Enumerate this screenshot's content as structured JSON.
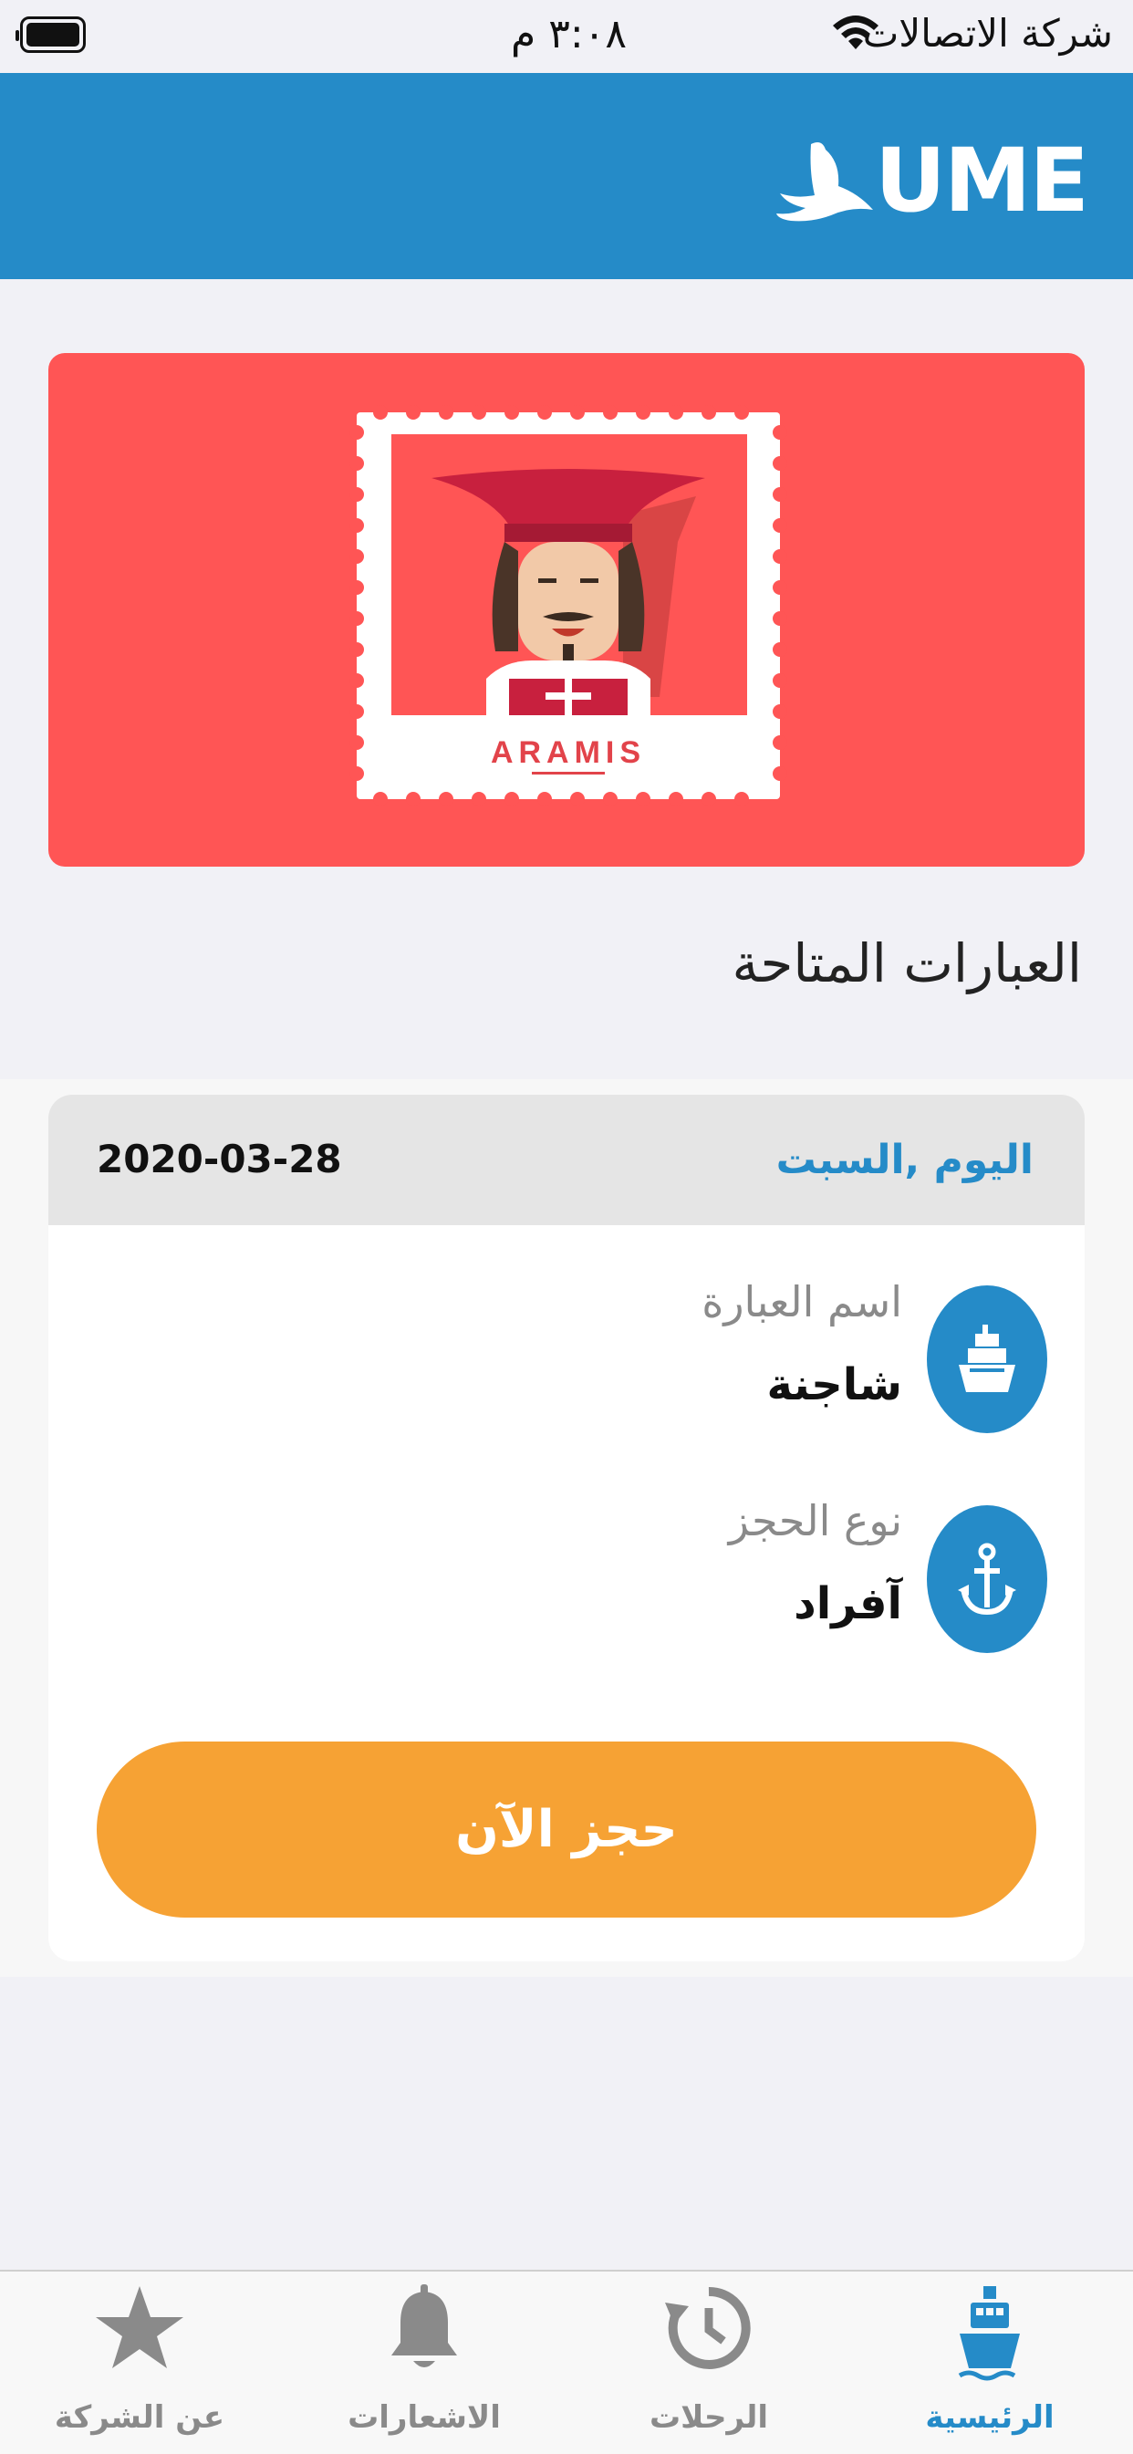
{
  "status_bar": {
    "time": "٣:٠٨ م",
    "carrier": "شركة الاتصالات"
  },
  "header": {
    "logo_text": "UME"
  },
  "hero": {
    "stamp_caption": "ARAMIS"
  },
  "section": {
    "title": "العبارات المتاحة"
  },
  "trip_card": {
    "day": "اليوم ,السبت",
    "date": "2020-03-28",
    "ferry_name_label": "اسم العبارة",
    "ferry_name_value": "شاجنة",
    "booking_type_label": "نوع الحجز",
    "booking_type_value": "آفراد",
    "book_button": "حجز الآن"
  },
  "tab_bar": {
    "items": [
      {
        "label": "الرئيسية",
        "icon": "ship-icon",
        "active": true
      },
      {
        "label": "الرحلات",
        "icon": "history-icon",
        "active": false
      },
      {
        "label": "الاشعارات",
        "icon": "bell-icon",
        "active": false
      },
      {
        "label": "عن الشركة",
        "icon": "star-icon",
        "active": false
      }
    ]
  },
  "colors": {
    "primary": "#258bc8",
    "accent": "#f6a234",
    "hero_bg": "#ff5555"
  }
}
